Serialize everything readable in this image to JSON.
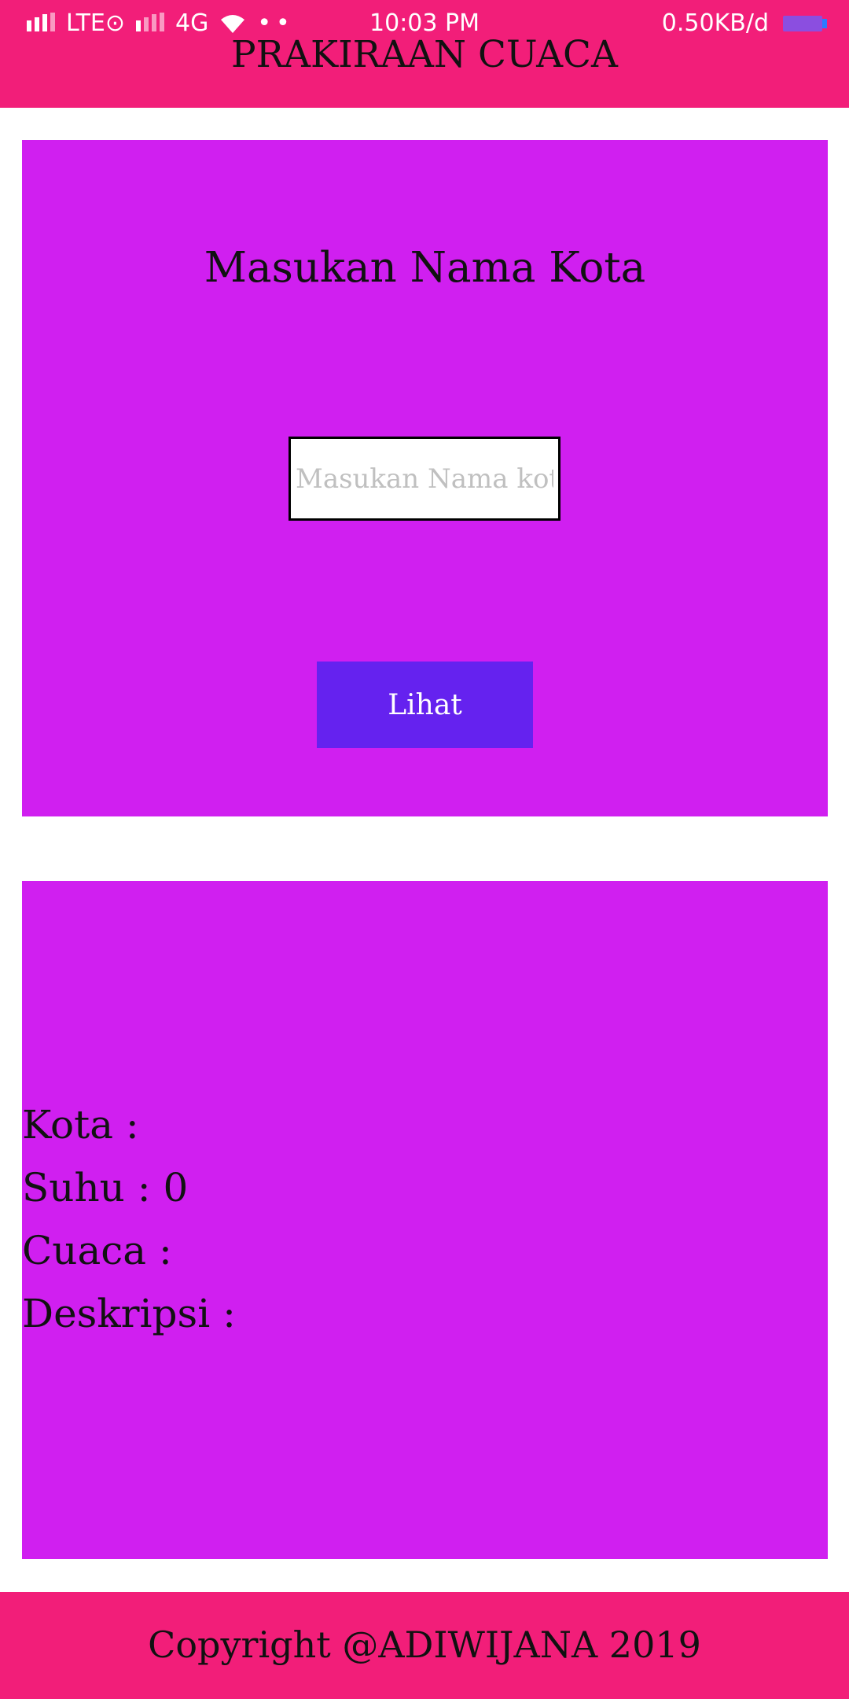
{
  "status_bar": {
    "network_lte": "LTE⊙",
    "network_4g": "4G",
    "dots": "••",
    "time": "10:03 PM",
    "speed": "0.50KB/d"
  },
  "header": {
    "title": "PRAKIRAAN CUACA"
  },
  "input_card": {
    "prompt": "Masukan Nama Kota",
    "city_input": {
      "placeholder": "Masukan Nama kota",
      "value": ""
    },
    "button_label": "Lihat"
  },
  "result_card": {
    "kota_label": "Kota : ",
    "kota_value": "",
    "suhu_label": "Suhu : ",
    "suhu_value": "0",
    "cuaca_label": "Cuaca : ",
    "cuaca_value": "",
    "deskripsi_label": "Deskripsi : ",
    "deskripsi_value": ""
  },
  "footer": {
    "copyright": "Copyright @ADIWIJANA 2019"
  },
  "colors": {
    "header_bg": "#f21e79",
    "card_bg": "#d01ff0",
    "button_bg": "#6522ef"
  }
}
